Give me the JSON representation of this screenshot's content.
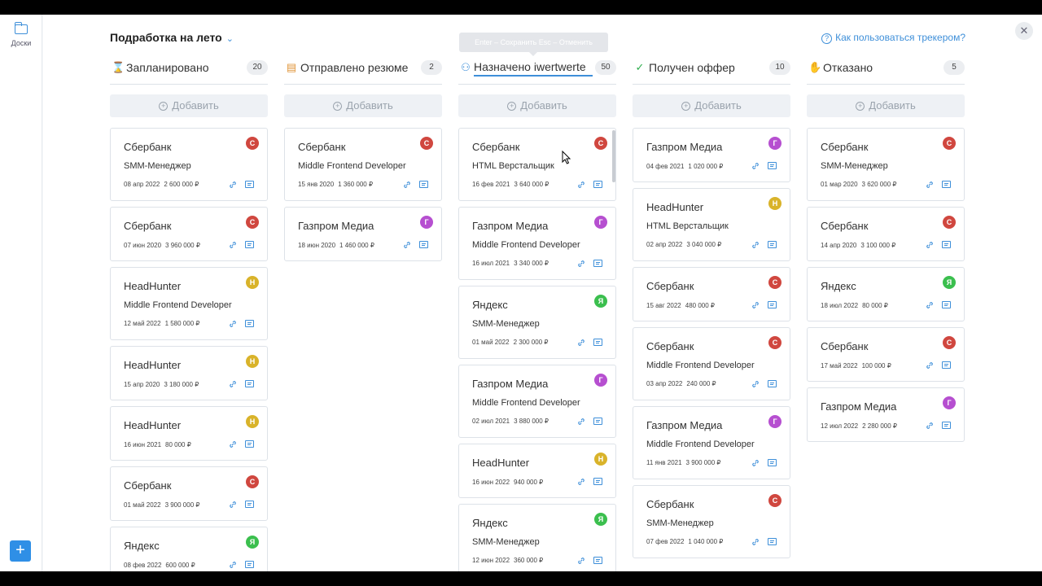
{
  "sidebar": {
    "boards_label": "Доски",
    "add_label": "+"
  },
  "header": {
    "board_title": "Подработка на лето",
    "help_text": "Как пользоваться трекером?",
    "help_q": "?",
    "close_label": "✕",
    "tooltip": "Enter – Сохранить  Esc – Отменить"
  },
  "add_label": "Добавить",
  "colors": {
    "С": "#d0473f",
    "Г": "#b64fd0",
    "Н": "#d9b32a",
    "Я": "#3bbf4e",
    "accent": "#3e8fd9"
  },
  "columns": [
    {
      "title": "Запланировано",
      "count": "20",
      "icon": "hourglass-icon",
      "cards": [
        {
          "company": "Сбербанк",
          "position": "SMM-Менеджер",
          "date": "08 апр 2022",
          "salary": "2 600 000 ₽",
          "avatar": "С"
        },
        {
          "company": "Сбербанк",
          "position": "",
          "date": "07 июн 2020",
          "salary": "3 960 000 ₽",
          "avatar": "С"
        },
        {
          "company": "HeadHunter",
          "position": "Middle Frontend Developer",
          "date": "12 май 2022",
          "salary": "1 580 000 ₽",
          "avatar": "Н"
        },
        {
          "company": "HeadHunter",
          "position": "",
          "date": "15 апр 2020",
          "salary": "3 180 000 ₽",
          "avatar": "Н"
        },
        {
          "company": "HeadHunter",
          "position": "",
          "date": "16 июн 2021",
          "salary": "80 000 ₽",
          "avatar": "Н"
        },
        {
          "company": "Сбербанк",
          "position": "",
          "date": "01 май 2022",
          "salary": "3 900 000 ₽",
          "avatar": "С"
        },
        {
          "company": "Яндекс",
          "position": "",
          "date": "08 фев 2022",
          "salary": "600 000 ₽",
          "avatar": "Я"
        }
      ]
    },
    {
      "title": "Отправлено резюме",
      "count": "2",
      "icon": "document-icon",
      "cards": [
        {
          "company": "Сбербанк",
          "position": "Middle Frontend Developer",
          "date": "15 янв 2020",
          "salary": "1 360 000 ₽",
          "avatar": "С"
        },
        {
          "company": "Газпром Медиа",
          "position": "",
          "date": "18 июн 2020",
          "salary": "1 460 000 ₽",
          "avatar": "Г"
        }
      ]
    },
    {
      "title": "Назначено iwertwerte",
      "count": "50",
      "icon": "people-icon",
      "editing": true,
      "cards": [
        {
          "company": "Сбербанк",
          "position": "HTML Верстальщик",
          "date": "16 фев 2021",
          "salary": "3 640 000 ₽",
          "avatar": "С"
        },
        {
          "company": "Газпром Медиа",
          "position": "Middle Frontend Developer",
          "date": "16 июл 2021",
          "salary": "3 340 000 ₽",
          "avatar": "Г"
        },
        {
          "company": "Яндекс",
          "position": "SMM-Менеджер",
          "date": "01 май 2022",
          "salary": "2 300 000 ₽",
          "avatar": "Я"
        },
        {
          "company": "Газпром Медиа",
          "position": "Middle Frontend Developer",
          "date": "02 июл 2021",
          "salary": "3 880 000 ₽",
          "avatar": "Г"
        },
        {
          "company": "HeadHunter",
          "position": "",
          "date": "16 июн 2022",
          "salary": "940 000 ₽",
          "avatar": "Н"
        },
        {
          "company": "Яндекс",
          "position": "SMM-Менеджер",
          "date": "12 июн 2022",
          "salary": "360 000 ₽",
          "avatar": "Я"
        }
      ]
    },
    {
      "title": "Получен оффер",
      "count": "10",
      "icon": "check-circle-icon",
      "cards": [
        {
          "company": "Газпром Медиа",
          "position": "",
          "date": "04 фев 2021",
          "salary": "1 020 000 ₽",
          "avatar": "Г"
        },
        {
          "company": "HeadHunter",
          "position": "HTML Верстальщик",
          "date": "02 апр 2022",
          "salary": "3 040 000 ₽",
          "avatar": "Н"
        },
        {
          "company": "Сбербанк",
          "position": "",
          "date": "15 авг 2022",
          "salary": "480 000 ₽",
          "avatar": "С"
        },
        {
          "company": "Сбербанк",
          "position": "Middle Frontend Developer",
          "date": "03 апр 2022",
          "salary": "240 000 ₽",
          "avatar": "С"
        },
        {
          "company": "Газпром Медиа",
          "position": "Middle Frontend Developer",
          "date": "11 янв 2021",
          "salary": "3 900 000 ₽",
          "avatar": "Г"
        },
        {
          "company": "Сбербанк",
          "position": "SMM-Менеджер",
          "date": "07 фев 2022",
          "salary": "1 040 000 ₽",
          "avatar": "С"
        }
      ]
    },
    {
      "title": "Отказано",
      "count": "5",
      "icon": "hand-stop-icon",
      "cards": [
        {
          "company": "Сбербанк",
          "position": "SMM-Менеджер",
          "date": "01 мар 2020",
          "salary": "3 620 000 ₽",
          "avatar": "С"
        },
        {
          "company": "Сбербанк",
          "position": "",
          "date": "14 апр 2020",
          "salary": "3 100 000 ₽",
          "avatar": "С"
        },
        {
          "company": "Яндекс",
          "position": "",
          "date": "18 июл 2022",
          "salary": "80 000 ₽",
          "avatar": "Я"
        },
        {
          "company": "Сбербанк",
          "position": "",
          "date": "17 май 2022",
          "salary": "100 000 ₽",
          "avatar": "С"
        },
        {
          "company": "Газпром Медиа",
          "position": "",
          "date": "12 июл 2022",
          "salary": "2 280 000 ₽",
          "avatar": "Г"
        }
      ]
    }
  ]
}
